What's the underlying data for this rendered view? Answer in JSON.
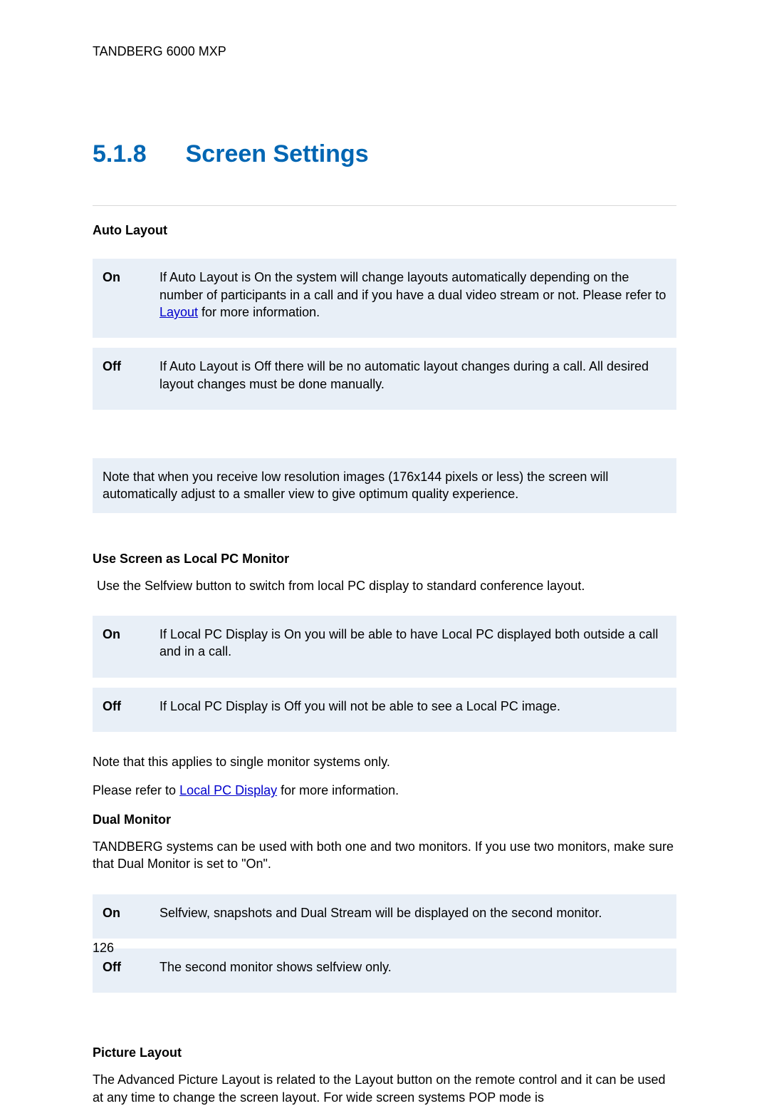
{
  "header": {
    "product": "TANDBERG 6000 MXP"
  },
  "section": {
    "number": "5.1.8",
    "title": "Screen Settings"
  },
  "autoLayout": {
    "heading": "Auto Layout",
    "rows": [
      {
        "label": "On",
        "pre": "If Auto Layout is On the system will change layouts automatically depending on the number of participants in a call and if you have a dual video stream or not. Please refer to ",
        "link": "Layout",
        "post": " for more information."
      },
      {
        "label": "Off",
        "text": "If Auto Layout is Off there will be no automatic layout changes during a call. All desired layout changes must be done manually."
      }
    ],
    "note": "Note that when you receive low resolution images (176x144 pixels or less) the screen will automatically adjust to a smaller view to give optimum quality experience."
  },
  "localPC": {
    "heading": "Use Screen as Local PC Monitor",
    "intro": "Use the Selfview button to switch from local PC display to standard conference layout.",
    "rows": [
      {
        "label": "On",
        "text": "If Local PC Display is On you will be able to have Local PC displayed both outside a call and in a call."
      },
      {
        "label": "Off",
        "text": "If Local PC Display is Off you will not be able to see a Local PC image."
      }
    ],
    "note1": "Note that this applies to single monitor systems only.",
    "refer_pre": "Please refer to ",
    "refer_link": "Local PC Display",
    "refer_post": " for more information."
  },
  "dualMonitor": {
    "heading": "Dual Monitor",
    "intro": "TANDBERG systems can be used with both one and two monitors. If you use two monitors, make sure that Dual Monitor is set to \"On\".",
    "rows": [
      {
        "label": "On",
        "text": "Selfview, snapshots and Dual Stream will be displayed on the second monitor."
      },
      {
        "label": "Off",
        "text": "The second monitor shows selfview only."
      }
    ]
  },
  "pictureLayout": {
    "heading": "Picture Layout",
    "intro": "The Advanced Picture Layout is related to the Layout button on the remote control and it can be used at any time to change the screen layout. For wide screen systems POP mode is"
  },
  "page": {
    "number": "126"
  }
}
